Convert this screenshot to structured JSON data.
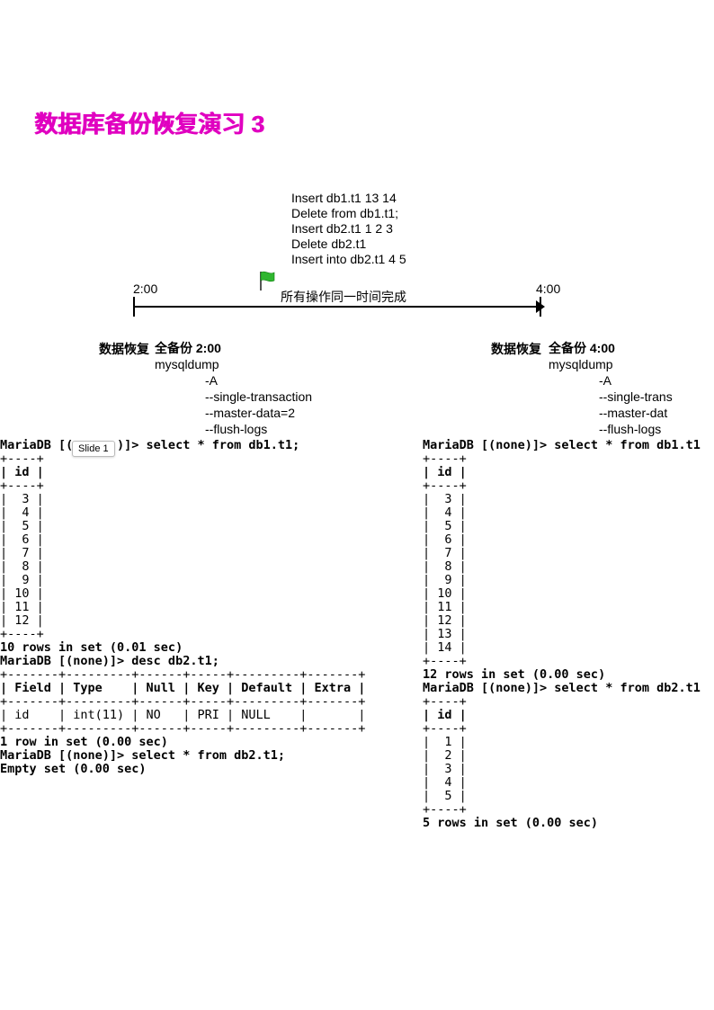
{
  "title": "数据库备份恢复演习 3",
  "ops": {
    "l1": "Insert db1.t1  13 14",
    "l2": "Delete from db1.t1;",
    "l3": "Insert db2.t1 1 2 3",
    "l4": "Delete db2.t1",
    "l5": "Insert into db2.t1 4 5"
  },
  "timeline": {
    "left": "2:00",
    "right": "4:00",
    "flag_text": "所有操作同一时间完成"
  },
  "recover_label": "数据恢复",
  "backup1": {
    "title": "全备份  2:00",
    "cmd": "mysqldump",
    "o1": "-A",
    "o2": "--single-transaction",
    "o3": "--master-data=2",
    "o4": "--flush-logs"
  },
  "backup2": {
    "title": "全备份  4:00",
    "cmd": "mysqldump",
    "o1": "-A",
    "o2": "--single-trans",
    "o3": "--master-dat",
    "o4": "--flush-logs"
  },
  "slide_badge": "Slide 1",
  "left_terminal": {
    "q1": "MariaDB [(      )]> select * from db1.t1;",
    "sep": "+----+",
    "hdr": "| id |",
    "r": [
      "|  3 |",
      "|  4 |",
      "|  5 |",
      "|  6 |",
      "|  7 |",
      "|  8 |",
      "|  9 |",
      "| 10 |",
      "| 11 |",
      "| 12 |"
    ],
    "s1": "10 rows in set (0.01 sec)",
    "q2": "MariaDB [(none)]> desc db2.t1;",
    "dsep": "+-------+---------+------+-----+---------+-------+",
    "dhdr": "| Field | Type    | Null | Key | Default | Extra |",
    "drow": "| id    | int(11) | NO   | PRI | NULL    |       |",
    "s2": "1 row in set (0.00 sec)",
    "q3": "MariaDB [(none)]> select * from db2.t1;",
    "s3": "Empty set (0.00 sec)"
  },
  "right_terminal": {
    "q1": "MariaDB [(none)]> select * from db1.t1",
    "sep": "+----+",
    "hdr": "| id |",
    "r": [
      "|  3 |",
      "|  4 |",
      "|  5 |",
      "|  6 |",
      "|  7 |",
      "|  8 |",
      "|  9 |",
      "| 10 |",
      "| 11 |",
      "| 12 |",
      "| 13 |",
      "| 14 |"
    ],
    "s1": "12 rows in set (0.00 sec)",
    "q2": "MariaDB [(none)]> select * from db2.t1",
    "r2": [
      "|  1 |",
      "|  2 |",
      "|  3 |",
      "|  4 |",
      "|  5 |"
    ],
    "s2": "5 rows in set (0.00 sec)"
  }
}
